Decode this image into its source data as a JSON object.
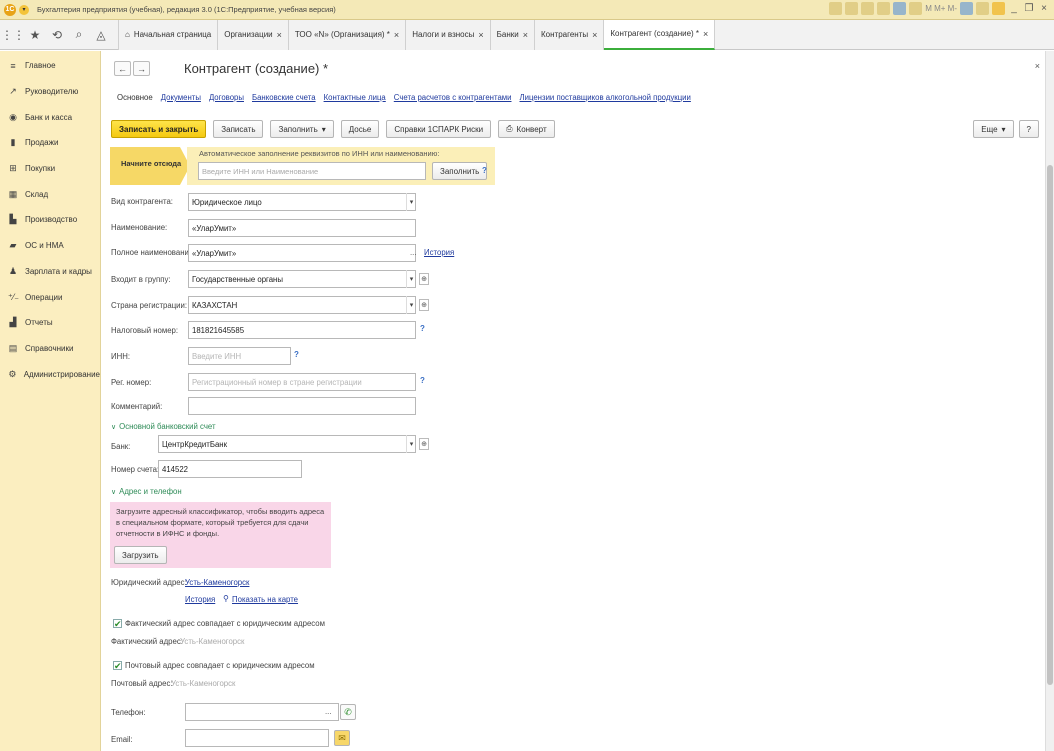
{
  "titlebar": {
    "title": "Бухгалтерия предприятия (учебная), редакция 3.0  (1С:Предприятие, учебная версия)",
    "icons": [
      "1c-logo-icon",
      "menu-icon"
    ],
    "right_text": "M  M+  M-"
  },
  "tabs": {
    "home": "Начальная страница",
    "items": [
      {
        "label": "Организации",
        "close": "×"
      },
      {
        "label": "ТОО «N» (Организация) *",
        "close": "×"
      },
      {
        "label": "Налоги и взносы",
        "close": "×"
      },
      {
        "label": "Банки",
        "close": "×"
      },
      {
        "label": "Контрагенты",
        "close": "×"
      },
      {
        "label": "Контрагент (создание) *",
        "close": "×"
      }
    ]
  },
  "sidebar": {
    "items": [
      {
        "label": "Главное",
        "icon": "≡"
      },
      {
        "label": "Руководителю",
        "icon": "↗"
      },
      {
        "label": "Банк и касса",
        "icon": "◉"
      },
      {
        "label": "Продажи",
        "icon": "▮"
      },
      {
        "label": "Покупки",
        "icon": "⊞"
      },
      {
        "label": "Склад",
        "icon": "▦"
      },
      {
        "label": "Производство",
        "icon": "▙"
      },
      {
        "label": "ОС и НМА",
        "icon": "▰"
      },
      {
        "label": "Зарплата и кадры",
        "icon": "♟"
      },
      {
        "label": "Операции",
        "icon": "⁺⁄₋"
      },
      {
        "label": "Отчеты",
        "icon": "▟"
      },
      {
        "label": "Справочники",
        "icon": "▤"
      },
      {
        "label": "Администрирование",
        "icon": "⚙"
      }
    ]
  },
  "form": {
    "title": "Контрагент (создание) *",
    "close": "×",
    "back": "←",
    "forward": "→",
    "links": [
      "Основное",
      "Документы",
      "Договоры",
      "Банковские счета",
      "Контактные лица",
      "Счета расчетов с контрагентами",
      "Лицензии поставщиков алкогольной продукции"
    ],
    "toolbar": {
      "save_close": "Записать и закрыть",
      "save": "Записать",
      "fill": "Заполнить",
      "fill_arrow": "▾",
      "dossier": "Досье",
      "spark": "Справки 1СПАРК Риски",
      "envelope": "Конверт",
      "more": "Еще",
      "help": "?"
    },
    "hint": {
      "start": "Начните отсюда",
      "text": "Автоматическое заполнение реквизитов по ИНН или наименованию:",
      "placeholder": "Введите ИНН или Наименование",
      "fill_button": "Заполнить",
      "q": "?"
    },
    "fields": {
      "kind_label": "Вид контрагента:",
      "kind_value": "Юридическое лицо",
      "name_label": "Наименование:",
      "name_value": "«УларУмит»",
      "fullname_label": "Полное наименование:",
      "fullname_value": "«УларУмит»",
      "history": "История",
      "group_label": "Входит в группу:",
      "group_value": "Государственные органы",
      "country_label": "Страна регистрации:",
      "country_value": "КАЗАХСТАН",
      "tax_label": "Налоговый номер:",
      "tax_value": "181821645585",
      "inn_label": "ИНН:",
      "inn_placeholder": "Введите ИНН",
      "reg_label": "Рег. номер:",
      "reg_placeholder": "Регистрационный номер в стране регистрации",
      "comment_label": "Комментарий:",
      "q": "?"
    },
    "bank": {
      "section": "Основной банковский счет",
      "bank_label": "Банк:",
      "bank_value": "ЦентрКредитБанк",
      "account_label": "Номер счета:",
      "account_value": "414522"
    },
    "address": {
      "section": "Адрес и телефон",
      "notice": "Загрузите адресный классификатор, чтобы вводить адреса в специальном формате, который требуется для сдачи отчетности в ИФНС и фонды.",
      "load_button": "Загрузить",
      "legal_label": "Юридический адрес:",
      "legal_value": "Усть-Каменогорск",
      "history": "История",
      "map": "Показать на карте",
      "actual_check": "Фактический адрес совпадает с юридическим адресом",
      "actual_label": "Фактический адрес:",
      "actual_value": "Усть-Каменогорск",
      "postal_check": "Почтовый адрес совпадает с юридическим адресом",
      "postal_label": "Почтовый адрес:",
      "postal_value": "Усть-Каменогорск",
      "phone_label": "Телефон:",
      "email_label": "Email:",
      "dots": "..."
    }
  },
  "colors": {
    "accent": "#f4c911",
    "sidebar": "#fbeec0",
    "link": "#1f3a9e",
    "section": "#2e8b57"
  }
}
